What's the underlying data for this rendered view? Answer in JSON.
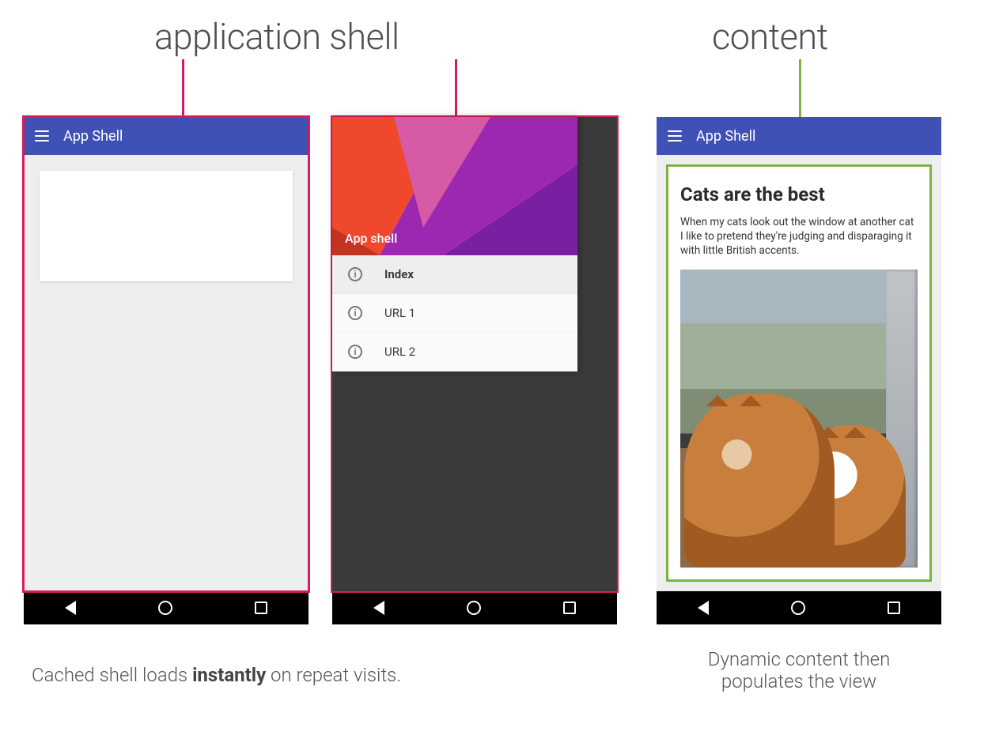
{
  "labels": {
    "appshell_heading": "application shell",
    "content_heading": "content"
  },
  "colors": {
    "outline_shell": "#d81b60",
    "outline_content": "#7cb342",
    "appbar": "#3f51b5"
  },
  "phone1": {
    "appbar_title": "App Shell"
  },
  "phone2": {
    "drawer_header_title": "App shell",
    "items": [
      {
        "label": "Index",
        "active": true
      },
      {
        "label": "URL 1",
        "active": false
      },
      {
        "label": "URL 2",
        "active": false
      }
    ]
  },
  "phone3": {
    "appbar_title": "App Shell",
    "article_title": "Cats are the best",
    "article_body": "When my cats look out the window at another cat I like to pretend they're judging and disparaging it with little British accents."
  },
  "captions": {
    "left_pre": "Cached shell loads ",
    "left_bold": "instantly",
    "left_post": " on repeat visits.",
    "right_line1": "Dynamic content then",
    "right_line2": "populates the view"
  }
}
